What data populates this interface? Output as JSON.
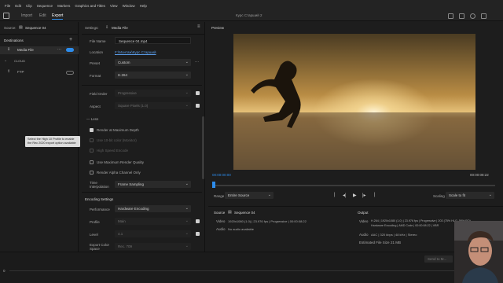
{
  "menu": [
    "File",
    "Edit",
    "Clip",
    "Sequence",
    "Markers",
    "Graphics and Titles",
    "View",
    "Window",
    "Help"
  ],
  "tabs": {
    "import": "Import",
    "edit": "Edit",
    "export": "Export"
  },
  "window_title": "Курс Старший 2",
  "left": {
    "source_label": "Source:",
    "source_value": "Sequence 04",
    "destinations": "Destinations",
    "media_file": "Media File",
    "cloud": "CLOUD",
    "ftp": "FTP",
    "tooltip": "Select the High 10 Profile to enable the Rec 2020 export option available"
  },
  "settings": {
    "header": "Settings:",
    "header_value": "Media File",
    "file_name_label": "File Name",
    "file_name_value": "Sequence 04.mp4",
    "location_label": "Location",
    "location_value": "F:\\Монтаж\\Курс Старший",
    "preset_label": "Preset",
    "preset_value": "Custom",
    "format_label": "Format",
    "format_value": "H.264",
    "field_order_label": "Field Order",
    "field_order_value": "Progressive",
    "aspect_label": "Aspect",
    "aspect_value": "Square Pixels (1.0)",
    "less": "Less",
    "render_max_depth": "Render at Maximum Depth",
    "use_vr": "Use 10-bit color (Monitor)",
    "high_speed": "High Speed Encode",
    "use_max_quality": "Use Maximum Render Quality",
    "render_alpha": "Render Alpha Channel Only",
    "time_interp_label": "Time Interpolation",
    "time_interp_value": "Frame Sampling",
    "encoding_header": "Encoding Settings",
    "performance_label": "Performance",
    "performance_value": "Hardware Encoding",
    "profile_label": "Profile",
    "profile_value": "Main",
    "level_label": "Level",
    "level_value": "4.1",
    "export_color_label": "Export Color Space",
    "export_color_value": "Rec. 709"
  },
  "preview": {
    "title": "Preview",
    "time_left": "00:00:00:00",
    "time_right": "00:00:08:22",
    "range_label": "Range",
    "range_value": "Entire Source",
    "scaling_label": "Scaling",
    "scaling_value": "Scale to fit"
  },
  "source_info": {
    "title": "Source",
    "seq": "Sequence 04",
    "video_label": "Video",
    "video_value": "1920x1080 (1.0)  |  23.976 fps  |  Progressive  |  00:00:08:22",
    "audio_label": "Audio",
    "audio_value": "No audio available"
  },
  "output_info": {
    "title": "Output",
    "video_label": "Video",
    "video_value": "H.264  |  1920x1080 (1.0)  |  23.976 fps  |  Progressive  |  203 (75% HLG, 58% PQ)",
    "video_value2": "Hardware Encoding  |  AMD Code  |  00:00:08:22  |  VBR",
    "audio_label": "Audio",
    "audio_value": "AAC  |  320 kbps  |  48 kHz  |  Stereo",
    "size_label": "Estimated File Size",
    "size_value": "21 MB"
  },
  "bottom": {
    "time": "0",
    "send_label": "Send to M..."
  },
  "colors": {
    "accent": "#2d8ceb",
    "bg": "#1d1d1d"
  }
}
